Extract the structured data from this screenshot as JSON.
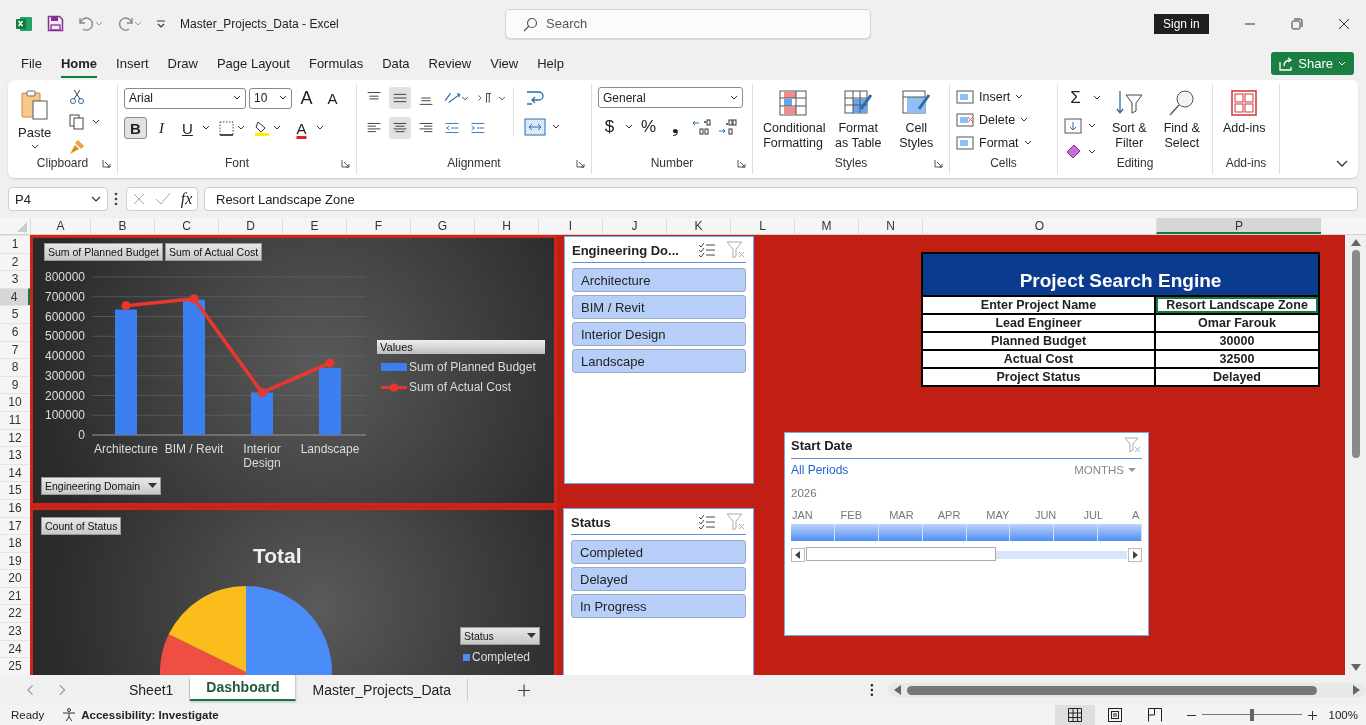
{
  "window": {
    "title": "Master_Projects_Data  -  Excel",
    "search_placeholder": "Search",
    "sign_in": "Sign in"
  },
  "menu_tabs": [
    {
      "label": "File",
      "selected": false
    },
    {
      "label": "Home",
      "selected": true
    },
    {
      "label": "Insert",
      "selected": false
    },
    {
      "label": "Draw",
      "selected": false
    },
    {
      "label": "Page Layout",
      "selected": false
    },
    {
      "label": "Formulas",
      "selected": false
    },
    {
      "label": "Data",
      "selected": false
    },
    {
      "label": "Review",
      "selected": false
    },
    {
      "label": "View",
      "selected": false
    },
    {
      "label": "Help",
      "selected": false
    }
  ],
  "share": "Share",
  "ribbon": {
    "clipboard": {
      "paste": "Paste",
      "label": "Clipboard"
    },
    "font": {
      "name": "Arial",
      "size": "10",
      "bold": true,
      "keys": {
        "grow": "A",
        "shrink": "A",
        "bold": "B",
        "italic": "I",
        "underline": "U",
        "font_color": "A"
      },
      "label": "Font"
    },
    "alignment": {
      "middle": true,
      "center": true,
      "label": "Alignment"
    },
    "number": {
      "format": "General",
      "currency": "$",
      "percent": "%",
      "comma": "❟",
      "label": "Number"
    },
    "styles": {
      "buttons": [
        "Conditional Formatting",
        "Format as Table",
        "Cell Styles"
      ],
      "label": "Styles"
    },
    "cells": {
      "buttons": [
        "Insert",
        "Delete",
        "Format"
      ],
      "label": "Cells"
    },
    "editing": {
      "sum": "Σ",
      "buttons": [
        "Sort & Filter",
        "Find & Select"
      ],
      "label": "Editing"
    },
    "addins": {
      "buttons": [
        "Add-ins"
      ],
      "label": "Add-ins"
    }
  },
  "formula_bar": {
    "name_box": "P4",
    "fx": "fx",
    "value": "Resort Landscape Zone"
  },
  "columns": [
    {
      "label": "A",
      "selected": false
    },
    {
      "label": "B",
      "selected": false
    },
    {
      "label": "C",
      "selected": false
    },
    {
      "label": "D",
      "selected": false
    },
    {
      "label": "E",
      "selected": false
    },
    {
      "label": "F",
      "selected": false
    },
    {
      "label": "G",
      "selected": false
    },
    {
      "label": "H",
      "selected": false
    },
    {
      "label": "I",
      "selected": false
    },
    {
      "label": "J",
      "selected": false
    },
    {
      "label": "K",
      "selected": false
    },
    {
      "label": "L",
      "selected": false
    },
    {
      "label": "M",
      "selected": false
    },
    {
      "label": "N",
      "selected": false
    },
    {
      "label": "O",
      "selected": false
    },
    {
      "label": "P",
      "selected": true
    }
  ],
  "rows": [
    {
      "label": "1",
      "selected": false
    },
    {
      "label": "2",
      "selected": false
    },
    {
      "label": "3",
      "selected": false
    },
    {
      "label": "4",
      "selected": true
    },
    {
      "label": "5",
      "selected": false
    },
    {
      "label": "6",
      "selected": false
    },
    {
      "label": "7",
      "selected": false
    },
    {
      "label": "8",
      "selected": false
    },
    {
      "label": "9",
      "selected": false
    },
    {
      "label": "10",
      "selected": false
    },
    {
      "label": "11",
      "selected": false
    },
    {
      "label": "12",
      "selected": false
    },
    {
      "label": "13",
      "selected": false
    },
    {
      "label": "14",
      "selected": false
    },
    {
      "label": "15",
      "selected": false
    },
    {
      "label": "16",
      "selected": false
    },
    {
      "label": "17",
      "selected": false
    },
    {
      "label": "18",
      "selected": false
    },
    {
      "label": "19",
      "selected": false
    },
    {
      "label": "20",
      "selected": false
    },
    {
      "label": "21",
      "selected": false
    },
    {
      "label": "22",
      "selected": false
    },
    {
      "label": "23",
      "selected": false
    },
    {
      "label": "24",
      "selected": false
    },
    {
      "label": "25",
      "selected": false
    }
  ],
  "bar_chart": {
    "field_buttons": [
      "Sum of Planned Budget",
      "Sum of Actual Cost"
    ],
    "axis_button": "Engineering Domain",
    "legend_title": "Values",
    "chart_data": {
      "type": "bar",
      "grid": true,
      "legend": true,
      "categories": [
        "Architecture",
        "BIM / Revit",
        "Interior Design",
        "Landscape"
      ],
      "ylim": [
        0,
        800000
      ],
      "yticks": [
        0,
        100000,
        200000,
        300000,
        400000,
        500000,
        600000,
        700000,
        800000
      ],
      "series": [
        {
          "name": "Sum of Planned Budget",
          "type": "bar",
          "color": "#3b7ff0",
          "values": [
            635000,
            685000,
            215000,
            340000
          ]
        },
        {
          "name": "Sum of Actual Cost",
          "type": "line",
          "marker": "circle",
          "color": "#e8382d",
          "values": [
            655000,
            690000,
            215000,
            365000
          ]
        }
      ]
    }
  },
  "pie_chart": {
    "field_button": "Count of Status",
    "title": "Total",
    "legend_button": "Status",
    "legend": [
      {
        "label": "Completed",
        "color": "#4b8df8"
      }
    ]
  },
  "slicers": [
    {
      "title": "Engineering Do...",
      "items": [
        {
          "label": "Architecture",
          "selected": true
        },
        {
          "label": "BIM / Revit",
          "selected": true
        },
        {
          "label": "Interior Design",
          "selected": true
        },
        {
          "label": "Landscape",
          "selected": true
        }
      ]
    },
    {
      "title": "Status",
      "items": [
        {
          "label": "Completed",
          "selected": true
        },
        {
          "label": "Delayed",
          "selected": true
        },
        {
          "label": "In Progress",
          "selected": true
        }
      ]
    }
  ],
  "search_engine": {
    "title": "Project Search Engine",
    "rows": [
      {
        "label": "Enter Project Name",
        "value": "Resort Landscape Zone",
        "selected": true
      },
      {
        "label": "Lead Engineer",
        "value": "Omar Farouk",
        "selected": false
      },
      {
        "label": "Planned Budget",
        "value": "30000",
        "selected": false
      },
      {
        "label": "Actual Cost",
        "value": "32500",
        "selected": false
      },
      {
        "label": "Project Status",
        "value": "Delayed",
        "selected": false
      }
    ]
  },
  "timeline": {
    "title": "Start Date",
    "periods": "All Periods",
    "unit": "MONTHS",
    "year": "2026",
    "months": [
      "JAN",
      "FEB",
      "MAR",
      "APR",
      "MAY",
      "JUN",
      "JUL",
      "A"
    ]
  },
  "sheet_tabs": [
    {
      "label": "Sheet1",
      "selected": false
    },
    {
      "label": "Dashboard",
      "selected": true
    },
    {
      "label": "Master_Projects_Data",
      "selected": false
    }
  ],
  "status_bar": {
    "ready": "Ready",
    "accessibility": "Accessibility: Investigate",
    "views": [
      {
        "kind": "normal",
        "selected": true
      },
      {
        "kind": "page_layout",
        "selected": false
      },
      {
        "kind": "page_break",
        "selected": false
      }
    ],
    "zoom": {
      "reading": "100%",
      "level": 0.5
    }
  }
}
